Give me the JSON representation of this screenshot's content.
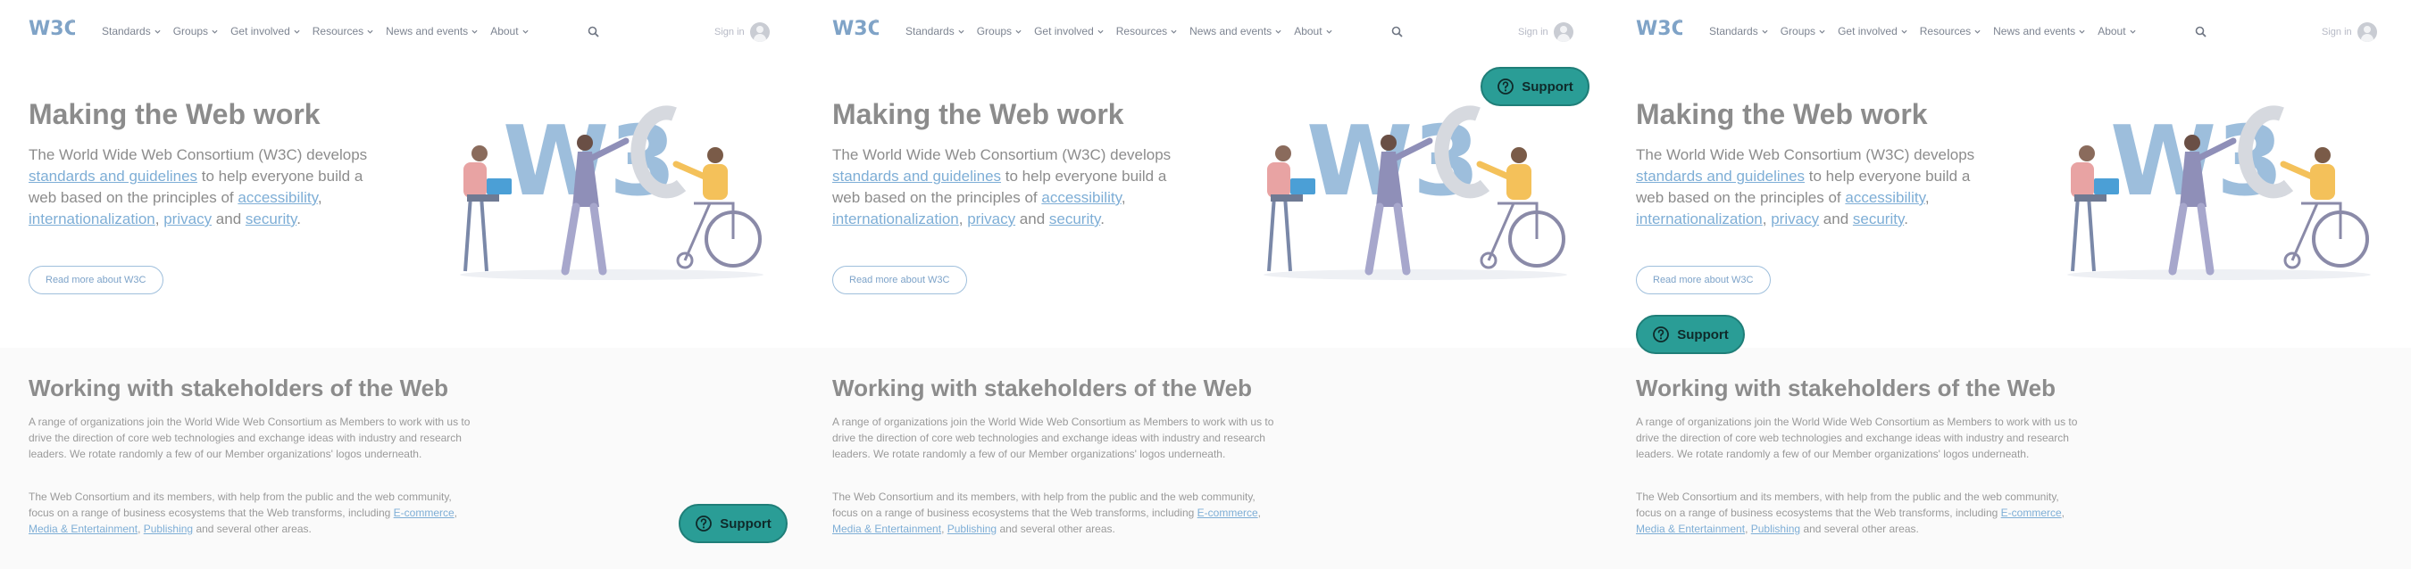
{
  "nav": {
    "items": [
      {
        "label": "Standards"
      },
      {
        "label": "Groups"
      },
      {
        "label": "Get involved"
      },
      {
        "label": "Resources"
      },
      {
        "label": "News and events"
      },
      {
        "label": "About"
      }
    ],
    "signin_label": "Sign in"
  },
  "hero": {
    "title": "Making the Web work",
    "text_1": "The World Wide Web Consortium (W3C) develops ",
    "link_standards": "standards and guidelines",
    "text_2": " to help everyone build a web based on the principles of ",
    "link_accessibility": "accessibility",
    "sep_1": ", ",
    "link_i18n": "internationalization",
    "sep_2": ", ",
    "link_privacy": "privacy",
    "text_3": " and ",
    "link_security": "security",
    "text_4": ".",
    "read_more_label": "Read more about W3C"
  },
  "stakeholders": {
    "title": "Working with stakeholders of the Web",
    "paragraph_1": "A range of organizations join the World Wide Web Consortium as Members to work with us to drive the direction of core web technologies and exchange ideas with industry and research leaders. We rotate randomly a few of our Member organizations' logos underneath.",
    "paragraph_2_start": "The Web Consortium and its members, with help from the public and the web community, focus on a range of business ecosystems that the Web transforms, including ",
    "link_ecommerce": "E-commerce",
    "sep_1": ", ",
    "link_media": "Media & Entertainment",
    "sep_2": ", ",
    "link_publishing": "Publishing",
    "paragraph_2_end": " and several other areas."
  },
  "support": {
    "label": "Support"
  },
  "colors": {
    "support_bg": "#2a9d96",
    "link": "#7eaed6",
    "logo": "#7fa3c7"
  }
}
